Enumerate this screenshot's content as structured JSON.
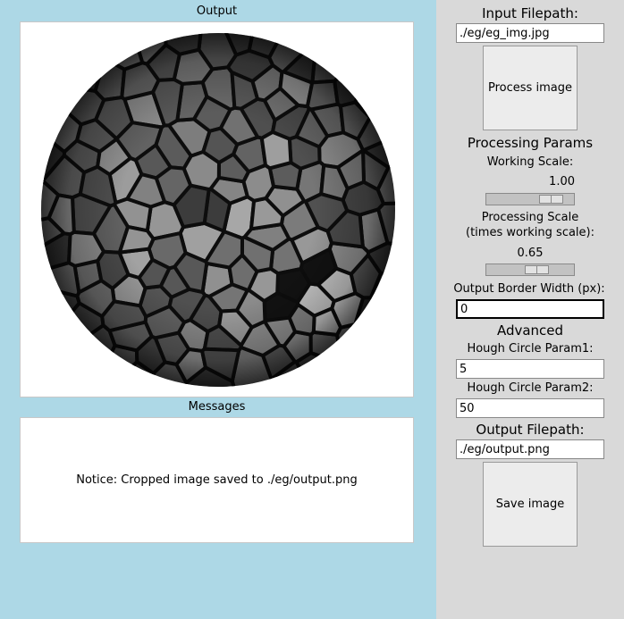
{
  "output_panel": {
    "label": "Output"
  },
  "messages_panel": {
    "label": "Messages",
    "text": "Notice: Cropped image saved to ./eg/output.png"
  },
  "controls": {
    "input_filepath_label": "Input Filepath:",
    "input_filepath_value": "./eg/eg_img.jpg",
    "process_button": "Process image",
    "processing_params_label": "Processing Params",
    "working_scale": {
      "label": "Working Scale:",
      "value": "1.00",
      "level": 0.83
    },
    "processing_scale": {
      "label_line1": "Processing Scale",
      "label_line2": "(times working scale):",
      "value": "0.65",
      "level": 0.61
    },
    "border_width": {
      "label": "Output Border Width (px):",
      "value": "0"
    },
    "advanced_label": "Advanced",
    "hough_param1": {
      "label": "Hough Circle Param1:",
      "value": "5"
    },
    "hough_param2": {
      "label": "Hough Circle Param2:",
      "value": "50"
    },
    "output_filepath_label": "Output Filepath:",
    "output_filepath_value": "./eg/output.png",
    "save_button": "Save image"
  }
}
